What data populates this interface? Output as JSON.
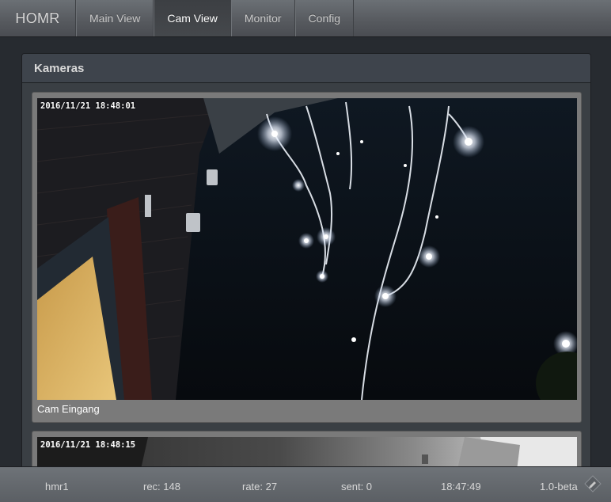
{
  "app": {
    "brand": "HOMR"
  },
  "nav": {
    "items": [
      {
        "label": "Main View",
        "active": false
      },
      {
        "label": "Cam View",
        "active": true
      },
      {
        "label": "Monitor",
        "active": false
      },
      {
        "label": "Config",
        "active": false
      }
    ]
  },
  "panel": {
    "title": "Kameras"
  },
  "cameras": [
    {
      "timestamp": "2016/11/21 18:48:01",
      "caption": "Cam Eingang"
    },
    {
      "timestamp": "2016/11/21 18:48:15",
      "caption": ""
    }
  ],
  "footer": {
    "host": "hmr1",
    "rec": "rec: 148",
    "rate": "rate: 27",
    "sent": "sent: 0",
    "time": "18:47:49",
    "version": "1.0-beta",
    "edit_icon": "pencil-icon"
  },
  "colors": {
    "navbar": "#56595e",
    "active_tab": "#3c3f43",
    "background": "#272b30",
    "panel": "#3a3f44"
  }
}
